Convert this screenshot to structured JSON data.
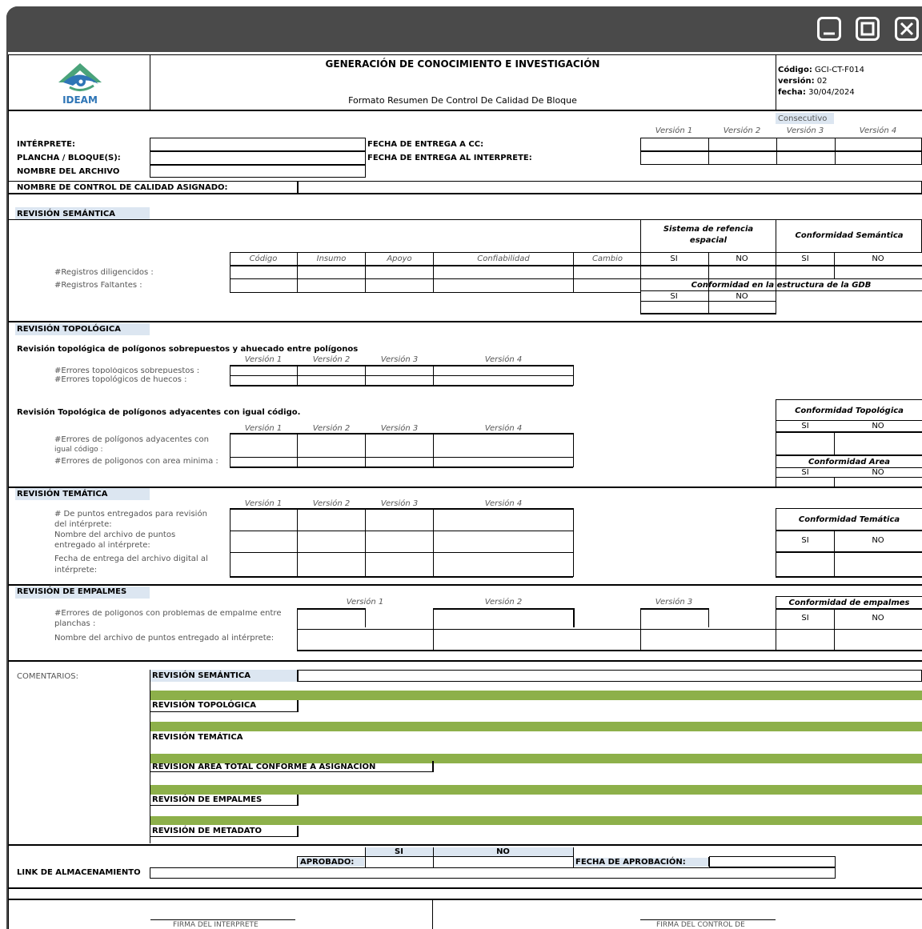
{
  "window": {
    "minimize_icon": "minimize-icon",
    "maximize_icon": "maximize-icon",
    "close_icon": "close-icon"
  },
  "header": {
    "logo_text": "IDEAM",
    "title": "GENERACIÓN DE CONOCIMIENTO E INVESTIGACIÓN",
    "subtitle": "Formato Resumen De Control De Calidad De Bloque",
    "codigo_label": "Código:",
    "codigo_value": "GCI-CT-F014",
    "version_label": "versión:",
    "version_value": "02",
    "fecha_label": "fecha:",
    "fecha_value": "30/04/2024",
    "consecutivo": "Consecutivo"
  },
  "versions": [
    "Versión 1",
    "Versión 2",
    "Versión 3",
    "Versión 4"
  ],
  "general": {
    "interprete": "INTÉRPRETE:",
    "plancha": "PLANCHA / BLOQUE(S):",
    "nombre_archivo": "NOMBRE DEL ARCHIVO",
    "fecha_cc": "FECHA DE ENTREGA A CC:",
    "fecha_interprete": "FECHA DE ENTREGA AL INTERPRETE:",
    "control_calidad": "NOMBRE DE CONTROL DE CALIDAD ASIGNADO:"
  },
  "semantica": {
    "heading": "REVISIÓN SEMÁNTICA",
    "columns": [
      "Código",
      "Insumo",
      "Apoyo",
      "Confiabilidad",
      "Cambio"
    ],
    "rows": [
      "#Registros diligencidos :",
      "#Registros Faltantes :"
    ],
    "sistema_ref_1": "Sistema de refencia",
    "sistema_ref_2": "espacial",
    "conformidad": "Conformidad Semántica",
    "estructura": "Conformidad en la estructura de la GDB",
    "si": "SI",
    "no": "NO"
  },
  "topologica": {
    "heading": "REVISIÓN TOPOLÓGICA",
    "sub1": "Revisión topológica de polígonos sobrepuestos y ahuecado entre polígonos",
    "sub1_rows": [
      "#Errores topológicos sobrepuestos :",
      "#Errores topológicos de huecos :"
    ],
    "sub2": "Revisión Topológica de polígonos adyacentes con igual código.",
    "sub2_row1_a": "#Errores de polígonos adyacentes con",
    "sub2_row1_b": "igual código :",
    "sub2_row2": "#Errores de poligonos con area minima :",
    "conformidad": "Conformidad Topológica",
    "conformidad_area": "Conformidad Area",
    "si": "SI",
    "no": "NO"
  },
  "tematica": {
    "heading": "REVISIÓN TEMÁTICA",
    "r1a": "# De puntos entregados para revisión",
    "r1b": "del intérprete:",
    "r2a": "Nombre del archivo de puntos",
    "r2b": "entregado al intérprete:",
    "r3a": "Fecha de entrega del archivo digital al",
    "r3b": "intérprete:",
    "conformidad": "Conformidad Temática",
    "si": "SI",
    "no": "NO"
  },
  "empalmes": {
    "heading": "REVISIÓN DE EMPALMES",
    "r1a": "#Errores de polígonos con problemas de empalme entre",
    "r1b": "planchas :",
    "r2": "Nombre del archivo de puntos entregado al intérprete:",
    "conformidad": "Conformidad de empalmes",
    "si": "SI",
    "no": "NO"
  },
  "comentarios": {
    "label": "COMENTARIOS:",
    "items": [
      "REVISIÓN SEMÁNTICA",
      "REVISIÓN TOPOLÓGICA",
      "REVISIÓN TEMÁTICA",
      "REVISIÓN AREA TOTAL CONFORME A ASIGNACIÓN",
      "REVISIÓN DE EMPALMES",
      "REVISIÓN DE METADATO"
    ]
  },
  "aprobacion": {
    "si": "SI",
    "no": "NO",
    "aprobado": "APROBADO:",
    "fecha": "FECHA DE APROBACIÓN:",
    "link": "LINK DE ALMACENAMIENTO"
  },
  "firmas": {
    "interprete": "FIRMA DEL INTERPRETE",
    "control": "FIRMA DEL CONTROL DE"
  },
  "colors": {
    "titlebar": "#4a4a4a",
    "section_fill": "#dce6f1",
    "green_bar": "#8db04a",
    "logo_blue": "#2e75b6",
    "logo_green": "#4aa37a"
  }
}
